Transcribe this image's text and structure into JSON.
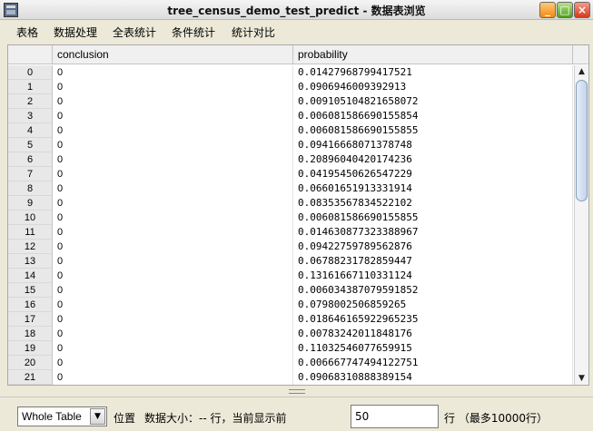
{
  "window": {
    "title": "tree_census_demo_test_predict - 数据表浏览",
    "minimize_glyph": "_",
    "maximize_glyph": "□",
    "close_glyph": "×"
  },
  "menu": [
    {
      "label": "表格"
    },
    {
      "label": "数据处理"
    },
    {
      "label": "全表统计"
    },
    {
      "label": "条件统计"
    },
    {
      "label": "统计对比"
    }
  ],
  "table": {
    "columns": [
      "conclusion",
      "probability"
    ],
    "rows": [
      {
        "index": "0",
        "conclusion": "0",
        "probability": "0.01427968799417521"
      },
      {
        "index": "1",
        "conclusion": "0",
        "probability": "0.0906946009392913"
      },
      {
        "index": "2",
        "conclusion": "0",
        "probability": "0.009105104821658072"
      },
      {
        "index": "3",
        "conclusion": "0",
        "probability": "0.006081586690155854"
      },
      {
        "index": "4",
        "conclusion": "0",
        "probability": "0.006081586690155855"
      },
      {
        "index": "5",
        "conclusion": "0",
        "probability": "0.09416668071378748"
      },
      {
        "index": "6",
        "conclusion": "0",
        "probability": "0.20896040420174236"
      },
      {
        "index": "7",
        "conclusion": "0",
        "probability": "0.04195450626547229"
      },
      {
        "index": "8",
        "conclusion": "0",
        "probability": "0.06601651913331914"
      },
      {
        "index": "9",
        "conclusion": "0",
        "probability": "0.08353567834522102"
      },
      {
        "index": "10",
        "conclusion": "0",
        "probability": "0.006081586690155855"
      },
      {
        "index": "11",
        "conclusion": "0",
        "probability": "0.014630877323388967"
      },
      {
        "index": "12",
        "conclusion": "0",
        "probability": "0.09422759789562876"
      },
      {
        "index": "13",
        "conclusion": "0",
        "probability": "0.06788231782859447"
      },
      {
        "index": "14",
        "conclusion": "0",
        "probability": "0.13161667110331124"
      },
      {
        "index": "15",
        "conclusion": "0",
        "probability": "0.006034387079591852"
      },
      {
        "index": "16",
        "conclusion": "0",
        "probability": "0.0798002506859265"
      },
      {
        "index": "17",
        "conclusion": "0",
        "probability": "0.018646165922965235"
      },
      {
        "index": "18",
        "conclusion": "0",
        "probability": "0.00783242011848176"
      },
      {
        "index": "19",
        "conclusion": "0",
        "probability": "0.11032546077659915"
      },
      {
        "index": "20",
        "conclusion": "0",
        "probability": "0.006667747494122751"
      },
      {
        "index": "21",
        "conclusion": "0",
        "probability": "0.09068310888389154"
      }
    ]
  },
  "footer": {
    "scope_select": "Whole Table",
    "position_label": "位置",
    "size_label": "数据大小：-- 行，当前显示前",
    "display_count": "50",
    "rows_suffix": "行 （最多10000行）"
  },
  "icons": {
    "app": "table-window-icon",
    "dropdown": "chevron-down-icon",
    "scroll_up": "arrow-up-icon",
    "scroll_down": "arrow-down-icon"
  }
}
